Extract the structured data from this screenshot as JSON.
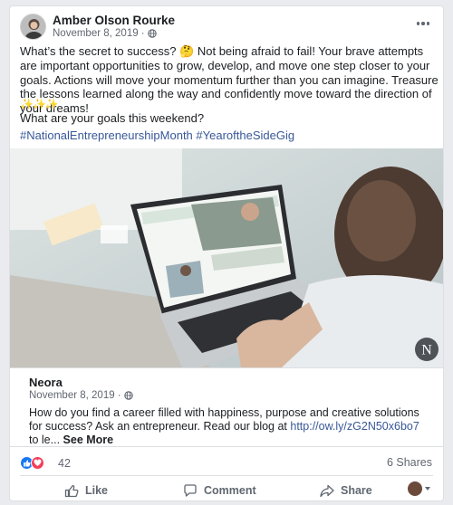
{
  "post": {
    "author": "Amber Olson Rourke",
    "date": "November 8, 2019 ·",
    "text": "What’s the secret to success? 🤔 Not being afraid to fail! Your brave attempts are important opportunities to grow, develop, and move one step closer to your goals. Actions will move your momentum further than you can imagine. Treasure the lessons learned along the way and confidently move toward the direction of your dreams!",
    "sparkles": "✨✨✨",
    "question": "What are your goals this weekend?",
    "hashtags": [
      "#NationalEntrepreneurshipMonth",
      "#YearoftheSideGig"
    ]
  },
  "image": {
    "watermark": "N"
  },
  "link_preview": {
    "title": "Neora",
    "date": "November 8, 2019 ·",
    "description": "How do you find a career filled with happiness, purpose and creative solutions for success? Ask an entrepreneur. Read our blog at ",
    "link": "http://ow.ly/zG2N50x6bo7",
    "ellipsis": " to le... ",
    "see_more": "See More"
  },
  "stats": {
    "reaction_count": "42",
    "shares": "6 Shares"
  },
  "actions": {
    "like": "Like",
    "comment": "Comment",
    "share": "Share"
  },
  "colors": {
    "brand_blue": "#1877f2",
    "link_blue": "#385898",
    "love_red": "#f33e58"
  }
}
